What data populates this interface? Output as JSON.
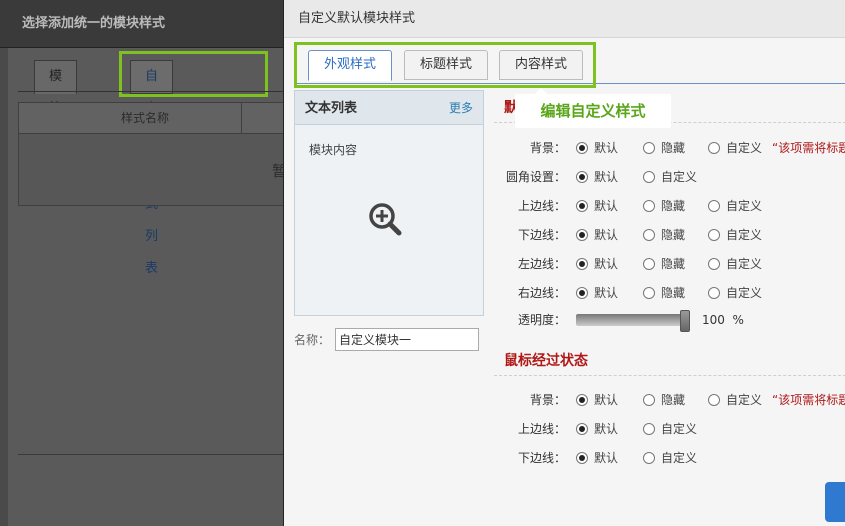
{
  "bg_dialog": {
    "title": "选择添加统一的模块样式",
    "tabs": [
      "模块样式",
      "自定义样式列表"
    ],
    "table_header": "样式名称",
    "empty_text": "暂"
  },
  "dialog": {
    "title": "自定义默认模块样式",
    "tabs": [
      "外观样式",
      "标题样式",
      "内容样式"
    ],
    "tooltip": "编辑自定义样式"
  },
  "preview": {
    "title": "文本列表",
    "more": "更多",
    "content": "模块内容",
    "zoom_icon": "zoom-in-icon"
  },
  "name_field": {
    "label": "名称：",
    "value": "自定义模块一"
  },
  "section_default": {
    "title": "默",
    "rows": [
      {
        "label": "背景：",
        "options": [
          "默认",
          "隐藏",
          "自定义"
        ],
        "selected": 0,
        "note": "“该项需将标题"
      },
      {
        "label": "圆角设置：",
        "options": [
          "默认",
          "自定义"
        ],
        "selected": 0
      },
      {
        "label": "上边线：",
        "options": [
          "默认",
          "隐藏",
          "自定义"
        ],
        "selected": 0
      },
      {
        "label": "下边线：",
        "options": [
          "默认",
          "隐藏",
          "自定义"
        ],
        "selected": 0
      },
      {
        "label": "左边线：",
        "options": [
          "默认",
          "隐藏",
          "自定义"
        ],
        "selected": 0
      },
      {
        "label": "右边线：",
        "options": [
          "默认",
          "隐藏",
          "自定义"
        ],
        "selected": 0
      }
    ],
    "opacity": {
      "label": "透明度：",
      "value": "100",
      "unit": "%"
    }
  },
  "section_hover": {
    "title": "鼠标经过状态",
    "rows": [
      {
        "label": "背景：",
        "options": [
          "默认",
          "隐藏",
          "自定义"
        ],
        "selected": 0,
        "note": "“该项需将标题"
      },
      {
        "label": "上边线：",
        "options": [
          "默认",
          "自定义"
        ],
        "selected": 0
      },
      {
        "label": "下边线：",
        "options": [
          "默认",
          "自定义"
        ],
        "selected": 0
      }
    ]
  },
  "colors": {
    "highlight": "#7ec21f",
    "accent_red": "#b01818",
    "tab_active": "#2d6bc4"
  }
}
